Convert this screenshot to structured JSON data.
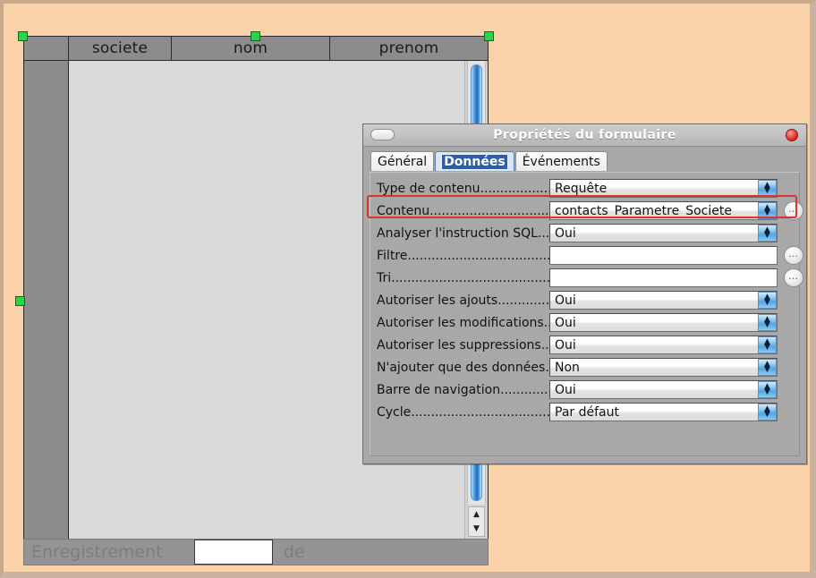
{
  "canvas": {
    "background_color": "#fad2a9",
    "handle_color": "#2ad44a"
  },
  "grid": {
    "columns": [
      "",
      "societe",
      "nom",
      "prenom"
    ],
    "rows": [],
    "scrollbar": {
      "up_arrow": "▲",
      "down_arrow": "▼"
    }
  },
  "record_bar": {
    "label": "Enregistrement",
    "value": "",
    "of_label": "de",
    "total": ""
  },
  "dialog": {
    "title": "Propriétés du formulaire",
    "window_button": "minimize-pill",
    "close_button": "close-circle",
    "close_color": "#e83a34",
    "tabs": [
      {
        "label": "Général",
        "selected": false
      },
      {
        "label": "Données",
        "selected": true
      },
      {
        "label": "Événements",
        "selected": false
      }
    ],
    "properties": [
      {
        "label": "Type de contenu....................",
        "type": "combo",
        "value": "Requête",
        "has_ellipsis": false
      },
      {
        "label": "Contenu..................................",
        "type": "combo",
        "value": "contacts_Parametre_Societe",
        "has_ellipsis": true,
        "highlighted": true
      },
      {
        "label": "Analyser l'instruction SQL......",
        "type": "combo",
        "value": "Oui",
        "has_ellipsis": false
      },
      {
        "label": "Filtre.......................................",
        "type": "text",
        "value": "",
        "has_ellipsis": true
      },
      {
        "label": "Tri...........................................",
        "type": "text",
        "value": "",
        "has_ellipsis": true
      },
      {
        "label": "Autoriser les ajouts...............",
        "type": "combo",
        "value": "Oui",
        "has_ellipsis": false
      },
      {
        "label": "Autoriser les modifications....",
        "type": "combo",
        "value": "Oui",
        "has_ellipsis": false
      },
      {
        "label": "Autoriser les suppressions.....",
        "type": "combo",
        "value": "Oui",
        "has_ellipsis": false
      },
      {
        "label": "N'ajouter que des données....",
        "type": "combo",
        "value": "Non",
        "has_ellipsis": false
      },
      {
        "label": "Barre de navigation...............",
        "type": "combo",
        "value": "Oui",
        "has_ellipsis": false
      },
      {
        "label": "Cycle.......................................",
        "type": "combo",
        "value": "Par défaut",
        "has_ellipsis": false
      }
    ],
    "ellipsis_label": "…"
  },
  "annotation": {
    "color": "#e03030",
    "target": "Contenu"
  }
}
